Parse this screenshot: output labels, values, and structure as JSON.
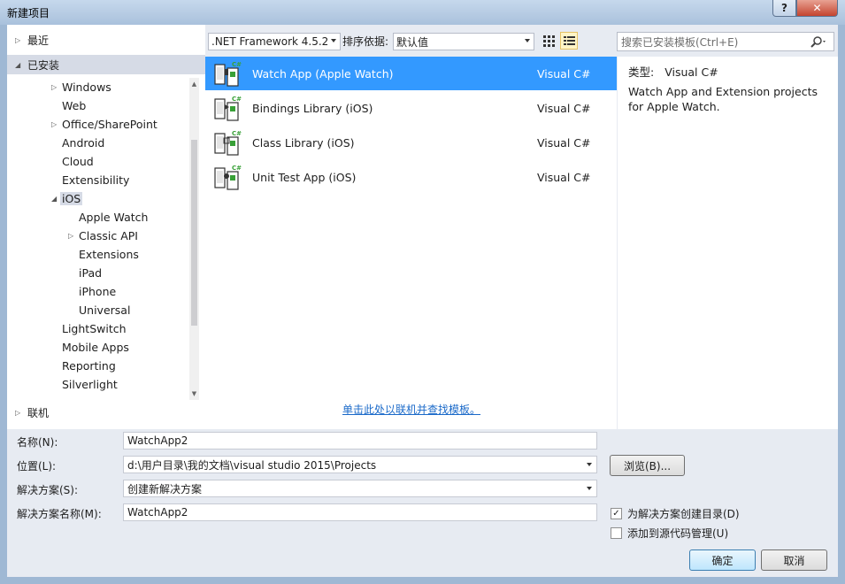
{
  "window": {
    "title": "新建项目",
    "help_label": "?",
    "close_label": "✕"
  },
  "categories": {
    "recent": "最近",
    "installed": "已安装",
    "online": "联机"
  },
  "tree": [
    {
      "label": "Windows",
      "level": 1,
      "expander": true
    },
    {
      "label": "Web",
      "level": 1,
      "expander": false
    },
    {
      "label": "Office/SharePoint",
      "level": 1,
      "expander": true
    },
    {
      "label": "Android",
      "level": 1,
      "expander": false
    },
    {
      "label": "Cloud",
      "level": 1,
      "expander": false
    },
    {
      "label": "Extensibility",
      "level": 1,
      "expander": false
    },
    {
      "label": "iOS",
      "level": 1,
      "expander": true,
      "expanded": true,
      "selected": true
    },
    {
      "label": "Apple Watch",
      "level": 2,
      "expander": false
    },
    {
      "label": "Classic API",
      "level": 2,
      "expander": true
    },
    {
      "label": "Extensions",
      "level": 2,
      "expander": false
    },
    {
      "label": "iPad",
      "level": 2,
      "expander": false
    },
    {
      "label": "iPhone",
      "level": 2,
      "expander": false
    },
    {
      "label": "Universal",
      "level": 2,
      "expander": false
    },
    {
      "label": "LightSwitch",
      "level": 1,
      "expander": false
    },
    {
      "label": "Mobile Apps",
      "level": 1,
      "expander": false
    },
    {
      "label": "Reporting",
      "level": 1,
      "expander": false
    },
    {
      "label": "Silverlight",
      "level": 1,
      "expander": false
    }
  ],
  "toolbar": {
    "framework": ".NET Framework 4.5.2",
    "sort_label": "排序依据:",
    "sort_value": "默认值",
    "search_placeholder": "搜索已安装模板(Ctrl+E)"
  },
  "templates": [
    {
      "name": "Watch App (Apple Watch)",
      "language": "Visual C#",
      "selected": true
    },
    {
      "name": "Bindings Library (iOS)",
      "language": "Visual C#",
      "selected": false
    },
    {
      "name": "Class Library (iOS)",
      "language": "Visual C#",
      "selected": false
    },
    {
      "name": "Unit Test App (iOS)",
      "language": "Visual C#",
      "selected": false
    }
  ],
  "online_link": "单击此处以联机并查找模板。",
  "details": {
    "type_label": "类型:",
    "type_value": "Visual C#",
    "description": "Watch App and Extension projects for Apple Watch."
  },
  "form": {
    "name_label": "名称(N):",
    "name_value": "WatchApp2",
    "location_label": "位置(L):",
    "location_value": "d:\\用户目录\\我的文档\\visual studio 2015\\Projects",
    "solution_label": "解决方案(S):",
    "solution_value": "创建新解决方案",
    "solution_name_label": "解决方案名称(M):",
    "solution_name_value": "WatchApp2",
    "browse_label": "浏览(B)...",
    "create_dir_label": "为解决方案创建目录(D)",
    "create_dir_checked": true,
    "source_control_label": "添加到源代码管理(U)",
    "source_control_checked": false,
    "ok_label": "确定",
    "cancel_label": "取消"
  },
  "colors": {
    "selection": "#3399ff",
    "link": "#1b6ac9",
    "accent": "#38a037"
  }
}
